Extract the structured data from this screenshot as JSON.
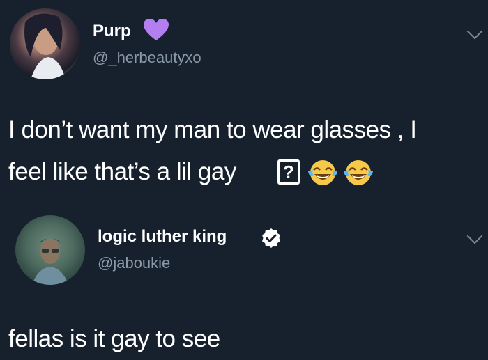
{
  "tweets": [
    {
      "display_name": "Purp",
      "handle": "@_herbeautyxo",
      "text_line_1": "I don’t want my man to wear glasses , I",
      "text_line_2": "feel like that’s a lil gay",
      "missing_glyph": "?",
      "emoji": [
        "face-with-tears-of-joy-icon",
        "face-with-tears-of-joy-icon"
      ],
      "name_badge": "purple-heart-icon"
    },
    {
      "display_name": "logic luther king",
      "handle": "@jaboukie",
      "text": "fellas is it gay to see",
      "name_badge": "verified-badge-icon"
    }
  ],
  "colors": {
    "background": "#17212d",
    "text": "#ffffff",
    "handle": "#8a99a8",
    "heart": "#b27ef0"
  }
}
